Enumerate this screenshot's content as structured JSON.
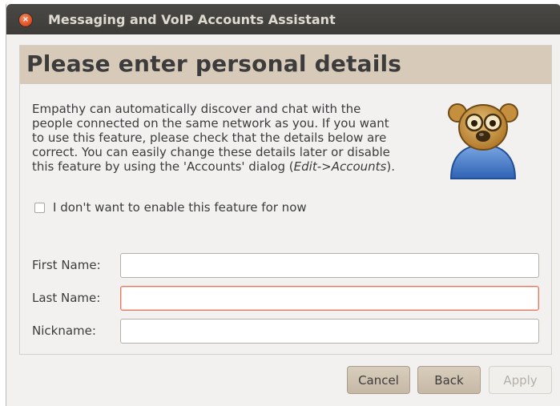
{
  "window": {
    "title": "Messaging and VoIP Accounts Assistant",
    "close_glyph": "×"
  },
  "header": {
    "title": "Please enter personal details"
  },
  "description": {
    "lines": [
      "Empathy can automatically discover and chat with the",
      "people connected on the same network as you. If you want",
      "to use this feature, please check that the details below are",
      "correct. You can easily change these details later or disable"
    ],
    "last_line_prefix": "this feature by using the 'Accounts' dialog (",
    "last_line_emphasis": "Edit->Accounts",
    "last_line_suffix": ")."
  },
  "opt_out": {
    "label": "I don't want to enable this feature for now",
    "checked": false
  },
  "form": {
    "first_name": {
      "label": "First Name:",
      "value": ""
    },
    "last_name": {
      "label": "Last Name:",
      "value": "",
      "state": "error"
    },
    "nickname": {
      "label": "Nickname:",
      "value": ""
    }
  },
  "buttons": {
    "cancel": "Cancel",
    "back": "Back",
    "apply": "Apply",
    "apply_disabled": true
  },
  "icons": {
    "close": "close-icon",
    "avatar": "people-nearby-avatar-icon",
    "checkbox": "checkbox-icon"
  },
  "colors": {
    "titlebar": "#3d3c38",
    "header_band": "#d7cab9",
    "error_border": "#e27a63",
    "close_button": "#df4a1c"
  }
}
